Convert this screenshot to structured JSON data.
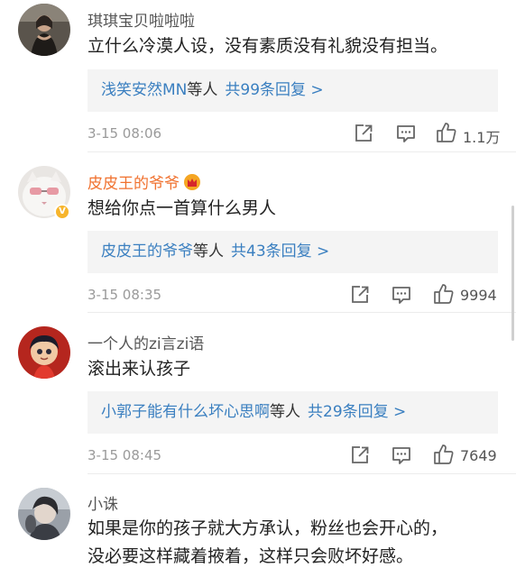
{
  "comments": [
    {
      "username": "琪琪宝贝啦啦啦",
      "text_lines": [
        "立什么冷漠人设，没有素质没有礼貌没有担当。"
      ],
      "reply": {
        "names": "浅笑安然MN",
        "middle": "等人",
        "count": "共99条回复 >"
      },
      "time": "3-15 08:06",
      "likes": "1.1万",
      "avatar": "woman-photo-avatar"
    },
    {
      "username": "皮皮王的爷爷",
      "vip_badge": "crown-badge-icon",
      "verified": true,
      "text_lines": [
        "想给你点一首算什么男人"
      ],
      "reply": {
        "names": "皮皮王的爷爷",
        "middle": "等人",
        "count": "共43条回复 >"
      },
      "time": "3-15 08:35",
      "likes": "9994",
      "avatar": "white-cat-avatar"
    },
    {
      "username": "一个人的zi言zi语",
      "text_lines": [
        "滚出来认孩子"
      ],
      "reply": {
        "names": "小郭子能有什么坏心思啊",
        "middle": "等人",
        "count": "共29条回复 >"
      },
      "time": "3-15 08:45",
      "likes": "7649",
      "avatar": "cartoon-girl-avatar"
    },
    {
      "username": "小诛",
      "text_lines": [
        "如果是你的孩子就大方承认，粉丝也会开心的，",
        "没必要这样藏着掖着，这样只会败坏好感。"
      ],
      "avatar": "dark-portrait-avatar"
    }
  ],
  "colors": {
    "link": "#3a7fc0",
    "vip_name": "#f0712e",
    "reply_bg": "#f4f4f4",
    "meta": "#9a9a9a"
  },
  "icons": [
    "share-icon",
    "comment-icon",
    "like-icon"
  ]
}
